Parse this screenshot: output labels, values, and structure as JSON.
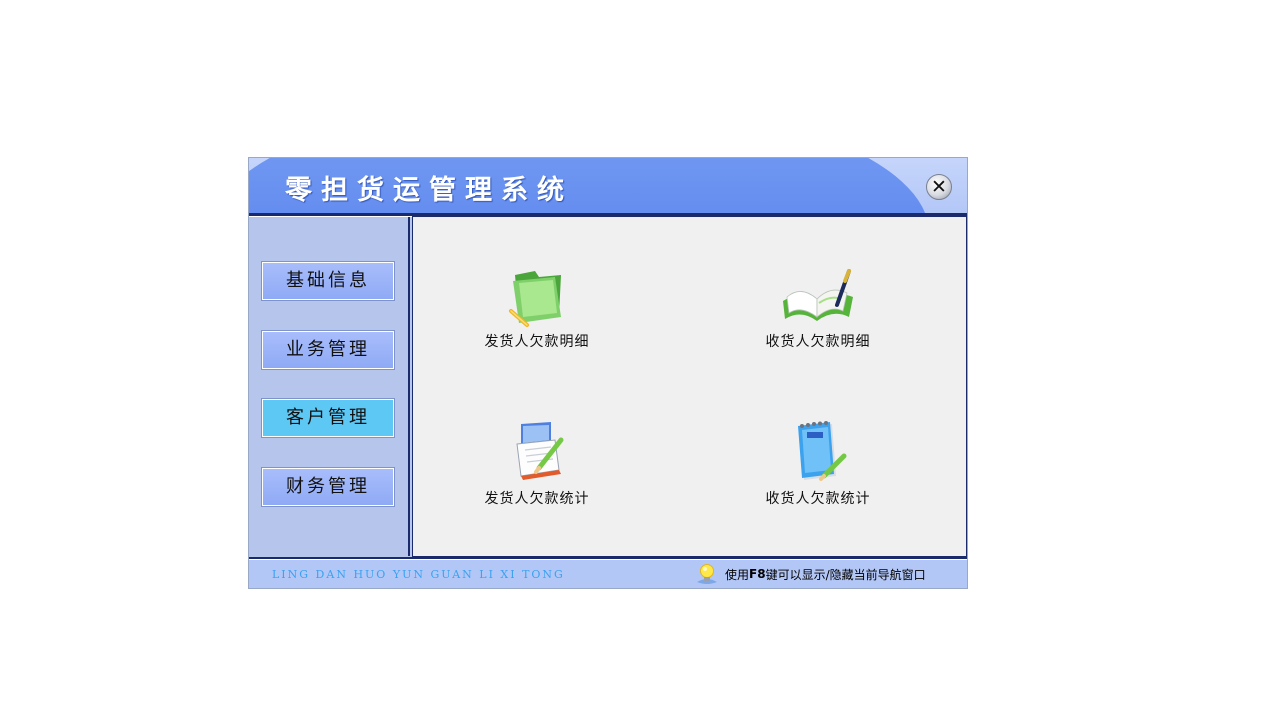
{
  "window": {
    "title": "零担货运管理系统",
    "close_symbol": "✕"
  },
  "sidebar": {
    "items": [
      {
        "label": "基础信息",
        "active": false
      },
      {
        "label": "业务管理",
        "active": false
      },
      {
        "label": "客户管理",
        "active": true
      },
      {
        "label": "财务管理",
        "active": false
      }
    ]
  },
  "content": {
    "tiles": [
      {
        "label": "发货人欠款明细",
        "icon": "green-folder-icon"
      },
      {
        "label": "收货人欠款明细",
        "icon": "open-book-pen-icon"
      },
      {
        "label": "发货人欠款统计",
        "icon": "calendar-pencil-icon"
      },
      {
        "label": "收货人欠款统计",
        "icon": "notepad-pencil-icon"
      }
    ]
  },
  "footer": {
    "pinyin": "LING DAN HUO YUN GUAN LI XI TONG",
    "tip_prefix": "使用",
    "tip_key": "F8",
    "tip_suffix": "键可以显示/隐藏当前导航窗口",
    "tip_icon": "lightbulb-icon"
  },
  "colors": {
    "title_blue": "#5c86ee",
    "sidebar_bg": "#b6c5ec",
    "nav_button": "#99b1f8",
    "nav_active": "#5ec8f4",
    "content_bg": "#f0f0f0",
    "pinyin_text": "#3aa2f0"
  }
}
